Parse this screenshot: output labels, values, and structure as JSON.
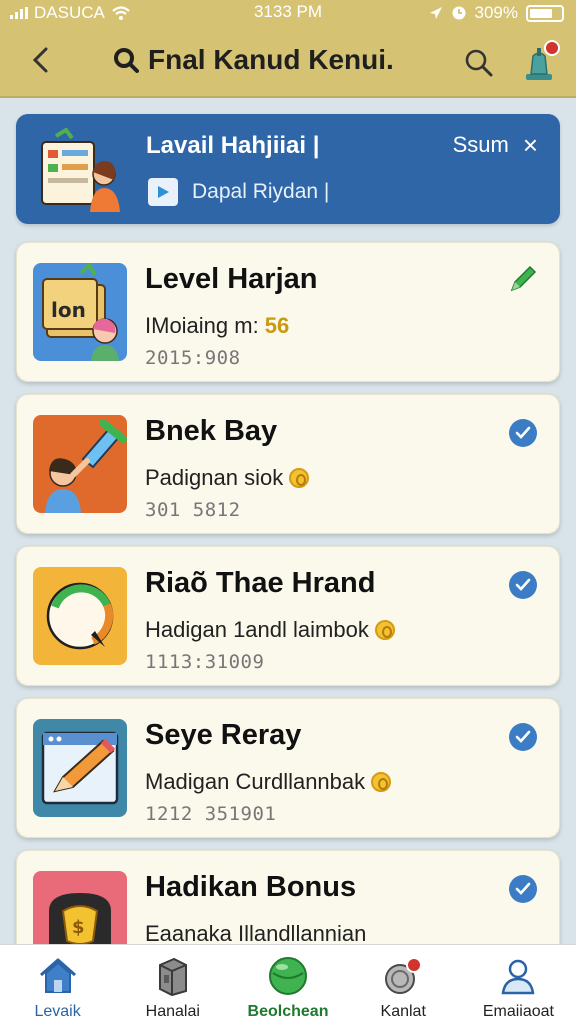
{
  "status_bar": {
    "carrier": "DASUCA",
    "time": "3133 PM",
    "battery": "309%"
  },
  "header": {
    "title": "Fnal Kanud Kenui."
  },
  "banner": {
    "title": "Lavail Hahjiiai |",
    "subtitle": "Dapal Riydan |",
    "action_label": "Ssum",
    "close_symbol": "×"
  },
  "cards": [
    {
      "title": "Level Harjan",
      "subtitle": "IMoiaing m:",
      "subtitle_value": "56",
      "meta": "2015:908",
      "status": "edit",
      "thumb_color": "#4a8fd8",
      "thumb_text": "lon"
    },
    {
      "title": "Bnek Bay",
      "subtitle": "Padignan siok",
      "meta": "301 5812",
      "status": "checked",
      "thumb_color": "#e06a2c"
    },
    {
      "title": "Riaõ Thae Hrand",
      "subtitle": "Hadigan 1andl laimbok",
      "meta": "1113:31009",
      "status": "checked",
      "thumb_color": "#f2b53a"
    },
    {
      "title": "Seye Reray",
      "subtitle": "Madigan Curdllannbak",
      "meta": "1212 351901",
      "status": "checked",
      "thumb_color": "#3f88a8"
    },
    {
      "title": "Hadikan Bonus",
      "subtitle": "Eaanaka Illandllannian",
      "meta": "",
      "status": "checked",
      "thumb_color": "#e96b7a"
    }
  ],
  "bottom_nav": [
    {
      "label": "Levaik",
      "icon": "home-icon"
    },
    {
      "label": "Hanalai",
      "icon": "box-icon"
    },
    {
      "label": "Beolchean",
      "icon": "ball-icon"
    },
    {
      "label": "Kanlat",
      "icon": "coin-notification-icon"
    },
    {
      "label": "Emaiiaoat",
      "icon": "profile-icon"
    }
  ],
  "colors": {
    "header_bg": "#d5c373",
    "banner_bg": "#2f66a8",
    "card_bg": "#fbf8ec",
    "check_blue": "#3c7cc4",
    "accent_green": "#3fb34f"
  }
}
